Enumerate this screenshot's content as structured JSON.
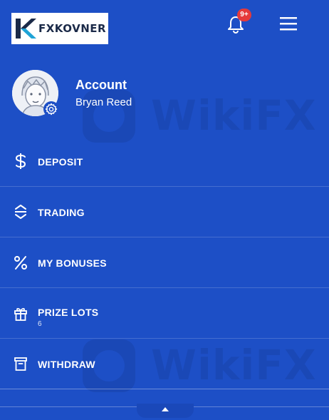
{
  "header": {
    "logo_text": "FXKOVNER",
    "notifications_badge": "9+"
  },
  "account": {
    "title": "Account",
    "name": "Bryan Reed"
  },
  "menu": [
    {
      "label": "DEPOSIT",
      "icon": "dollar-icon"
    },
    {
      "label": "TRADING",
      "icon": "trade-arrows-icon"
    },
    {
      "label": "MY BONUSES",
      "icon": "percent-icon"
    },
    {
      "label": "PRIZE LOTS",
      "icon": "gift-icon",
      "sub": "6"
    },
    {
      "label": "WITHDRAW",
      "icon": "archive-icon"
    }
  ],
  "watermark": {
    "text": "WikiFX"
  },
  "colors": {
    "background": "#1d4fc6",
    "badge": "#e53a3a",
    "logo_accent": "#1fa3d6"
  }
}
